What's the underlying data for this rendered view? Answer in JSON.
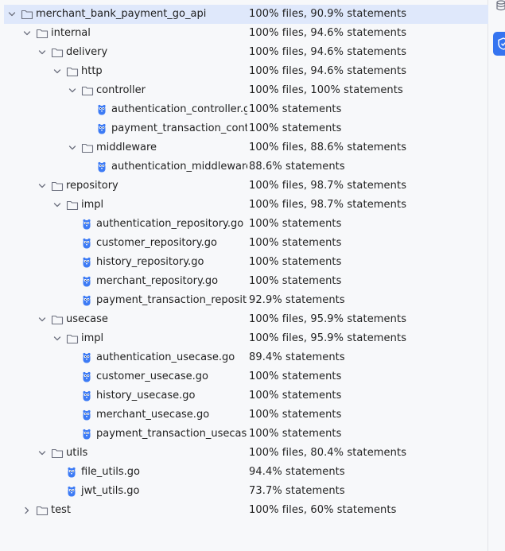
{
  "tree": [
    {
      "label": "merchant_bank_payment_go_api",
      "stats": "100% files, 90.9% statements",
      "depth": 0,
      "type": "folder",
      "expanded": true,
      "selected": true
    },
    {
      "label": "internal",
      "stats": "100% files, 94.6% statements",
      "depth": 1,
      "type": "folder",
      "expanded": true
    },
    {
      "label": "delivery",
      "stats": "100% files, 94.6% statements",
      "depth": 2,
      "type": "folder",
      "expanded": true
    },
    {
      "label": "http",
      "stats": "100% files, 94.6% statements",
      "depth": 3,
      "type": "folder",
      "expanded": true
    },
    {
      "label": "controller",
      "stats": "100% files, 100% statements",
      "depth": 4,
      "type": "folder",
      "expanded": true
    },
    {
      "label": "authentication_controller.go",
      "stats": "100% statements",
      "depth": 5,
      "type": "file"
    },
    {
      "label": "payment_transaction_controller.go",
      "stats": "100% statements",
      "depth": 5,
      "type": "file"
    },
    {
      "label": "middleware",
      "stats": "100% files, 88.6% statements",
      "depth": 4,
      "type": "folder",
      "expanded": true
    },
    {
      "label": "authentication_middleware.go",
      "stats": "88.6% statements",
      "depth": 5,
      "type": "file"
    },
    {
      "label": "repository",
      "stats": "100% files, 98.7% statements",
      "depth": 2,
      "type": "folder",
      "expanded": true
    },
    {
      "label": "impl",
      "stats": "100% files, 98.7% statements",
      "depth": 3,
      "type": "folder",
      "expanded": true
    },
    {
      "label": "authentication_repository.go",
      "stats": "100% statements",
      "depth": 4,
      "type": "file"
    },
    {
      "label": "customer_repository.go",
      "stats": "100% statements",
      "depth": 4,
      "type": "file"
    },
    {
      "label": "history_repository.go",
      "stats": "100% statements",
      "depth": 4,
      "type": "file"
    },
    {
      "label": "merchant_repository.go",
      "stats": "100% statements",
      "depth": 4,
      "type": "file"
    },
    {
      "label": "payment_transaction_repository.go",
      "stats": "92.9% statements",
      "depth": 4,
      "type": "file"
    },
    {
      "label": "usecase",
      "stats": "100% files, 95.9% statements",
      "depth": 2,
      "type": "folder",
      "expanded": true
    },
    {
      "label": "impl",
      "stats": "100% files, 95.9% statements",
      "depth": 3,
      "type": "folder",
      "expanded": true
    },
    {
      "label": "authentication_usecase.go",
      "stats": "89.4% statements",
      "depth": 4,
      "type": "file"
    },
    {
      "label": "customer_usecase.go",
      "stats": "100% statements",
      "depth": 4,
      "type": "file"
    },
    {
      "label": "history_usecase.go",
      "stats": "100% statements",
      "depth": 4,
      "type": "file"
    },
    {
      "label": "merchant_usecase.go",
      "stats": "100% statements",
      "depth": 4,
      "type": "file"
    },
    {
      "label": "payment_transaction_usecase.go",
      "stats": "100% statements",
      "depth": 4,
      "type": "file"
    },
    {
      "label": "utils",
      "stats": "100% files, 80.4% statements",
      "depth": 2,
      "type": "folder",
      "expanded": true
    },
    {
      "label": "file_utils.go",
      "stats": "94.4% statements",
      "depth": 3,
      "type": "file"
    },
    {
      "label": "jwt_utils.go",
      "stats": "73.7% statements",
      "depth": 3,
      "type": "file"
    },
    {
      "label": "test",
      "stats": "100% files, 60% statements",
      "depth": 1,
      "type": "folder",
      "expanded": false
    }
  ],
  "icons": {
    "folder": "folder-icon",
    "file": "go-gopher-file-icon",
    "expanded": "chevron-down-icon",
    "collapsed": "chevron-right-icon",
    "side_tool": "database-icon",
    "side_active": "coverage-shield-icon"
  },
  "colors": {
    "selection": "#dfe8fb",
    "accent": "#3574f0",
    "gopher": "#3d7bf5"
  }
}
